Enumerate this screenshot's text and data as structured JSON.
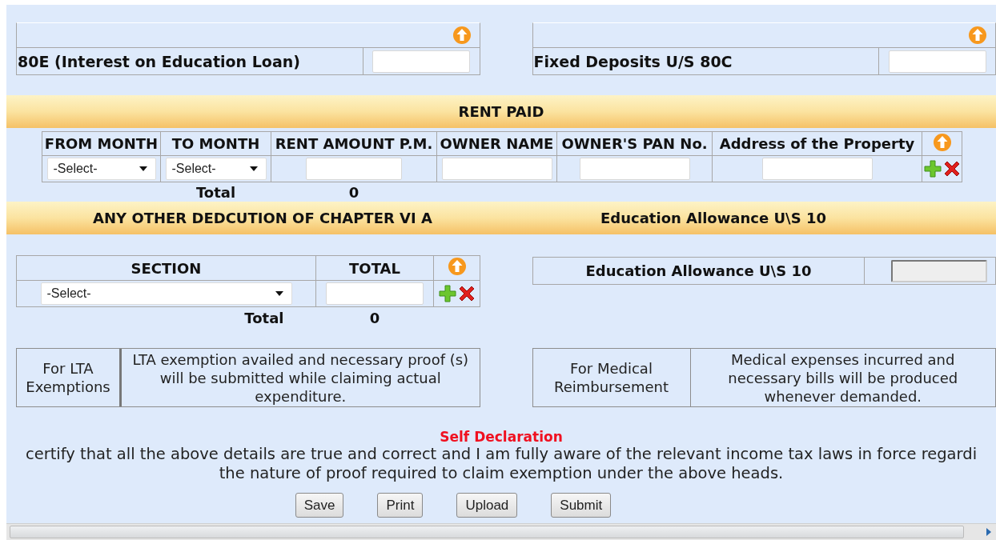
{
  "top_boxes": [
    {
      "label": "80E (Interest on Education Loan)"
    },
    {
      "label": "Fixed Deposits U/S 80C"
    }
  ],
  "rent_paid": {
    "title": "RENT PAID",
    "columns": [
      "FROM MONTH",
      "TO MONTH",
      "RENT AMOUNT P.M.",
      "OWNER NAME",
      "OWNER'S PAN No.",
      "Address of the Property"
    ],
    "cells": [
      {
        "kind": "select",
        "value": "-Select-"
      },
      {
        "kind": "select",
        "value": "-Select-"
      },
      {
        "kind": "input"
      },
      {
        "kind": "input"
      },
      {
        "kind": "input"
      },
      {
        "kind": "input"
      }
    ],
    "total_label": "Total",
    "total_value": "0"
  },
  "banner": {
    "left_title": "ANY OTHER DEDCUTION OF CHAPTER VI A",
    "right_title": "Education Allowance U\\S 10"
  },
  "other_deductions": {
    "columns": [
      "SECTION",
      "TOTAL"
    ],
    "section": "-Select-",
    "total_label": "Total",
    "total_value": "0"
  },
  "education_allowance": {
    "label": "Education Allowance U\\S 10",
    "disabled": true
  },
  "notes": [
    {
      "label": "For LTA Exemptions",
      "text": "LTA exemption availed and necessary proof (s) will be submitted while claiming actual expenditure."
    },
    {
      "label": "For Medical Reimbursement",
      "text": "Medical expenses incurred and necessary bills will be produced whenever demanded."
    }
  ],
  "self_declaration": {
    "title": "Self Declaration",
    "lines": [
      "certify that all the above details are true and correct and I am fully aware of the relevant income tax laws in force regardi",
      "the nature of proof required to claim exemption under the above heads."
    ]
  },
  "buttons": [
    "Save",
    "Print",
    "Upload",
    "Submit"
  ]
}
